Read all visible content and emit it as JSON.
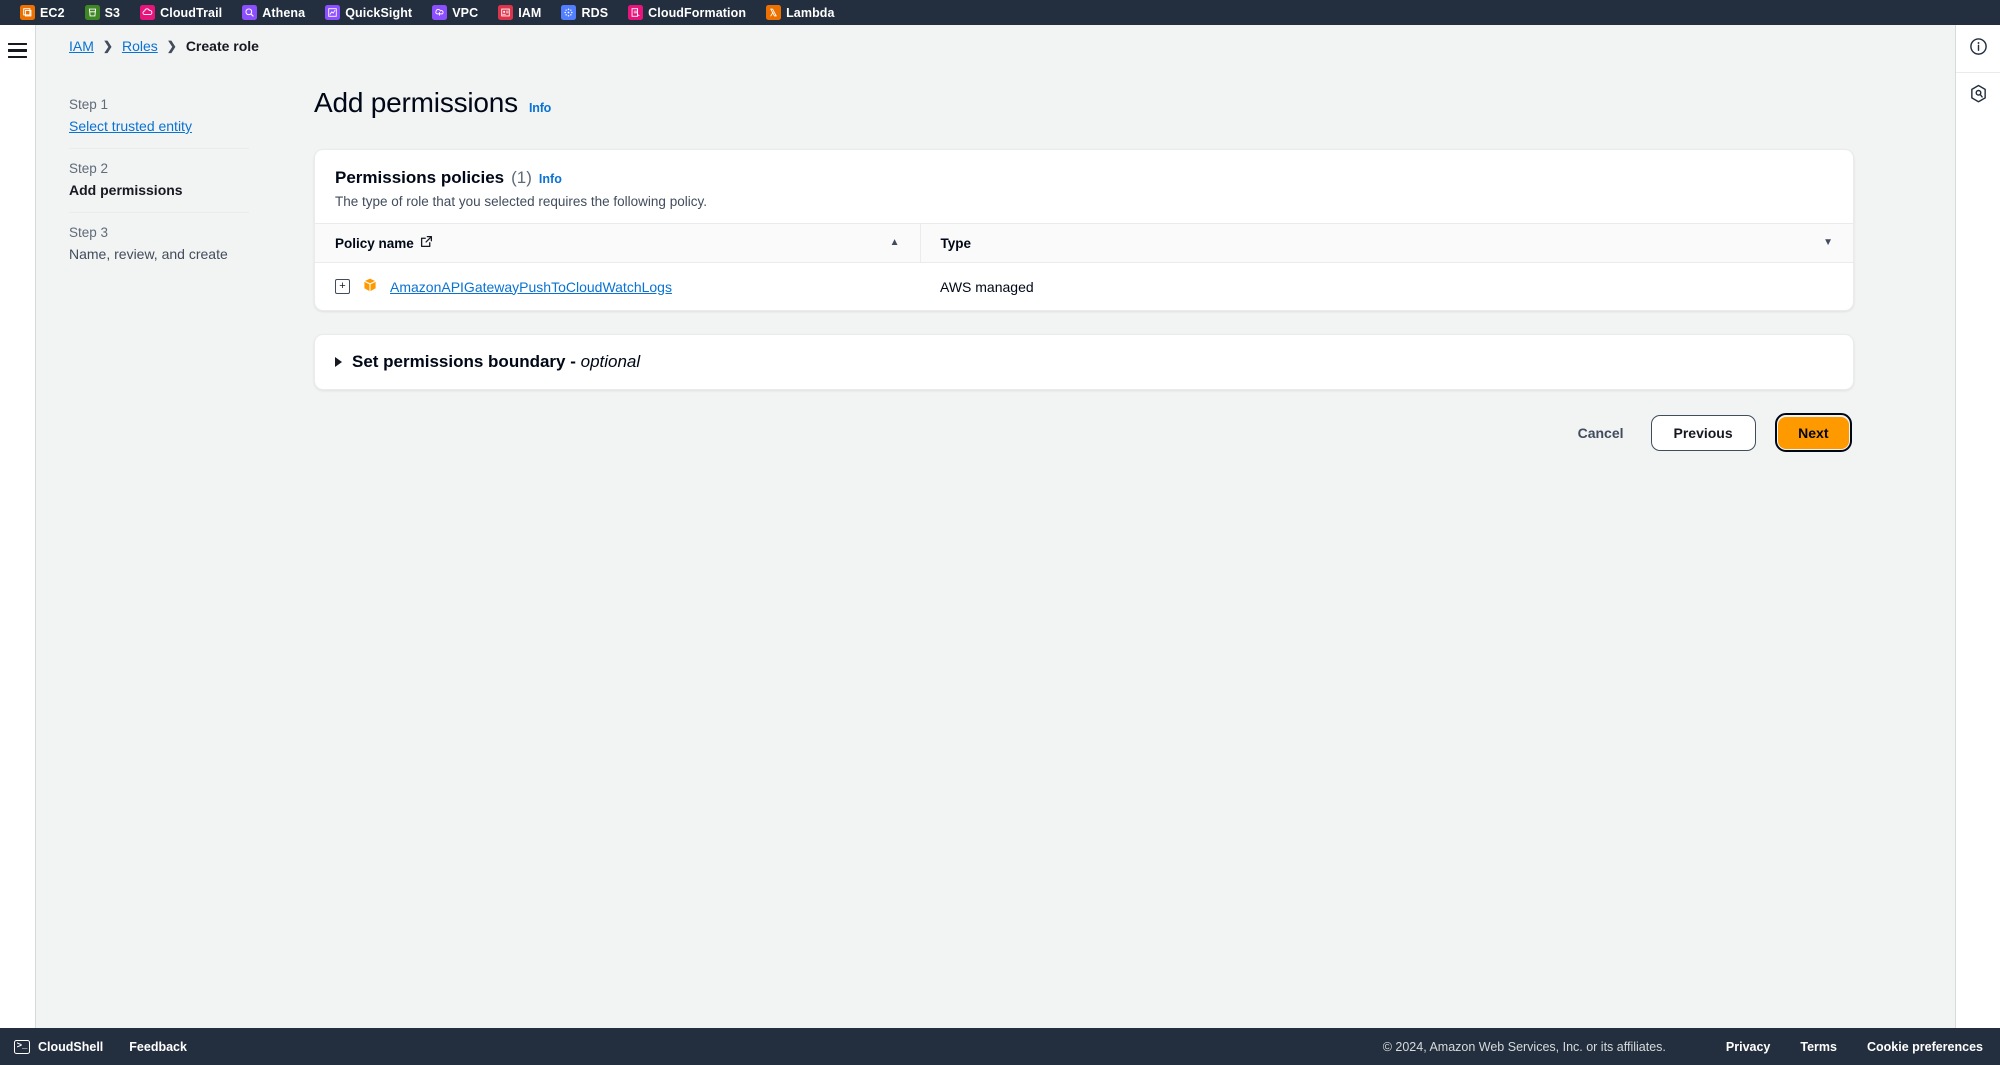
{
  "bookmarks": [
    {
      "label": "EC2",
      "icon": "ec2-icon",
      "color": "#ed7100"
    },
    {
      "label": "S3",
      "icon": "s3-icon",
      "color": "#3f8624"
    },
    {
      "label": "CloudTrail",
      "icon": "cloudtrail-icon",
      "color": "#e7157b"
    },
    {
      "label": "Athena",
      "icon": "athena-icon",
      "color": "#8c4fff"
    },
    {
      "label": "QuickSight",
      "icon": "quicksight-icon",
      "color": "#8c4fff"
    },
    {
      "label": "VPC",
      "icon": "vpc-icon",
      "color": "#8c4fff"
    },
    {
      "label": "IAM",
      "icon": "iam-icon",
      "color": "#dd344c"
    },
    {
      "label": "RDS",
      "icon": "rds-icon",
      "color": "#527fff"
    },
    {
      "label": "CloudFormation",
      "icon": "cloudformation-icon",
      "color": "#e7157b"
    },
    {
      "label": "Lambda",
      "icon": "lambda-icon",
      "color": "#ed7100"
    }
  ],
  "breadcrumb": {
    "items": [
      {
        "label": "IAM",
        "is_link": true
      },
      {
        "label": "Roles",
        "is_link": true
      },
      {
        "label": "Create role",
        "is_link": false
      }
    ],
    "separator": "❯"
  },
  "steps": [
    {
      "step_label": "Step 1",
      "title": "Select trusted entity",
      "state": "link"
    },
    {
      "step_label": "Step 2",
      "title": "Add permissions",
      "state": "active"
    },
    {
      "step_label": "Step 3",
      "title": "Name, review, and create",
      "state": "upcoming"
    }
  ],
  "main": {
    "title": "Add permissions",
    "info_label": "Info",
    "permissions_card": {
      "title": "Permissions policies",
      "count": "(1)",
      "info_label": "Info",
      "description": "The type of role that you selected requires the following policy.",
      "columns": [
        {
          "label": "Policy name",
          "has_external_link": true,
          "sort": "asc"
        },
        {
          "label": "Type",
          "has_external_link": false,
          "sort": "desc"
        }
      ],
      "rows": [
        {
          "expand": "+",
          "policy_name": "AmazonAPIGatewayPushToCloudWatchLogs",
          "type": "AWS managed"
        }
      ]
    },
    "permissions_boundary": {
      "title": "Set permissions boundary",
      "optional_suffix": "optional",
      "expanded": false
    },
    "actions": {
      "cancel": "Cancel",
      "previous": "Previous",
      "next": "Next",
      "next_accent_color": "#ff9900"
    }
  },
  "right_rail": [
    {
      "icon": "info-circle-icon"
    },
    {
      "icon": "hexagon-settings-icon"
    }
  ],
  "bottom_bar": {
    "cloudshell": "CloudShell",
    "cloudshell_icon": "terminal-icon",
    "feedback": "Feedback",
    "copyright": "© 2024, Amazon Web Services, Inc. or its affiliates.",
    "links": [
      "Privacy",
      "Terms",
      "Cookie preferences"
    ]
  }
}
